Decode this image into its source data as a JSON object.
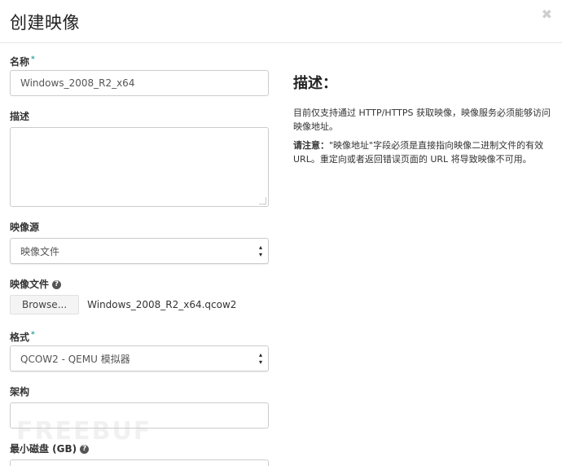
{
  "modal": {
    "title": "创建映像",
    "close_glyph": "✖"
  },
  "form": {
    "name": {
      "label": "名称",
      "required_mark": "*",
      "value": "Windows_2008_R2_x64"
    },
    "description": {
      "label": "描述",
      "value": ""
    },
    "image_source": {
      "label": "映像源",
      "selected": "映像文件"
    },
    "image_file": {
      "label": "映像文件",
      "help_glyph": "?",
      "browse_label": "Browse...",
      "file_name": "Windows_2008_R2_x64.qcow2"
    },
    "format": {
      "label": "格式",
      "required_mark": "*",
      "selected": "QCOW2 - QEMU 模拟器"
    },
    "architecture": {
      "label": "架构",
      "value": ""
    },
    "min_disk": {
      "label": "最小磁盘 (GB)",
      "help_glyph": "?"
    }
  },
  "description_panel": {
    "title": "描述：",
    "paragraph1": "目前仅支持通过 HTTP/HTTPS 获取映像，映像服务必须能够访问映像地址。",
    "note_label": "请注意：",
    "note_text": "\"映像地址\"字段必须是直接指向映像二进制文件的有效 URL。重定向或者返回错误页面的 URL 将导致映像不可用。"
  },
  "watermark": {
    "text": "FREEBUF"
  }
}
